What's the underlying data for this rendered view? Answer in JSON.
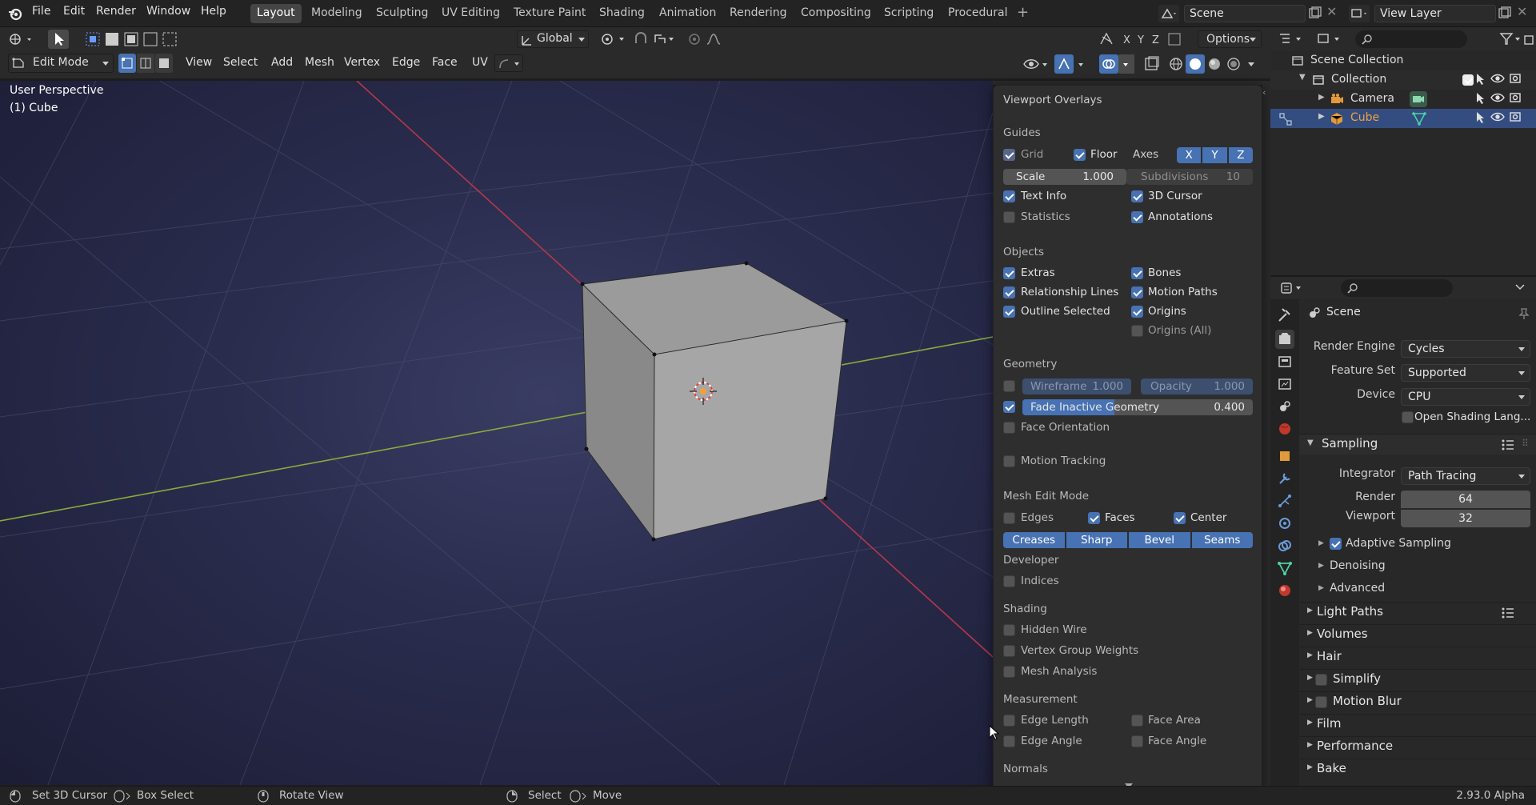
{
  "menu": {
    "file": "File",
    "edit": "Edit",
    "render": "Render",
    "window": "Window",
    "help": "Help"
  },
  "workspaces": [
    "Layout",
    "Modeling",
    "Sculpting",
    "UV Editing",
    "Texture Paint",
    "Shading",
    "Animation",
    "Rendering",
    "Compositing",
    "Scripting",
    "Procedural"
  ],
  "top_right": {
    "scene": "Scene",
    "view_layer": "View Layer"
  },
  "toolbar": {
    "orientation": "Global",
    "options": "Options"
  },
  "viewport_header": {
    "mode": "Edit Mode",
    "view": "View",
    "select": "Select",
    "add": "Add",
    "mesh": "Mesh",
    "vertex": "Vertex",
    "edge": "Edge",
    "face": "Face",
    "uv": "UV"
  },
  "viewport_info": {
    "perspective": "User Perspective",
    "object": "(1) Cube"
  },
  "overlays": {
    "title": "Viewport Overlays",
    "guides": "Guides",
    "grid": "Grid",
    "floor": "Floor",
    "axes": "Axes",
    "x": "X",
    "y": "Y",
    "z": "Z",
    "scale_label": "Scale",
    "scale_value": "1.000",
    "subdiv_label": "Subdivisions",
    "subdiv_value": "10",
    "text_info": "Text Info",
    "cursor_3d": "3D Cursor",
    "statistics": "Statistics",
    "annotations": "Annotations",
    "objects": "Objects",
    "extras": "Extras",
    "bones": "Bones",
    "relationship_lines": "Relationship Lines",
    "motion_paths": "Motion Paths",
    "outline_selected": "Outline Selected",
    "origins": "Origins",
    "origins_all": "Origins (All)",
    "geometry": "Geometry",
    "wireframe_label": "Wireframe",
    "wireframe_value": "1.000",
    "opacity_label": "Opacity",
    "opacity_value": "1.000",
    "fade_label": "Fade Inactive Geometry",
    "fade_value": "0.400",
    "fade_fraction": 0.4,
    "face_orientation": "Face Orientation",
    "motion_tracking": "Motion Tracking",
    "mesh_edit_mode": "Mesh Edit Mode",
    "edges": "Edges",
    "faces": "Faces",
    "center": "Center",
    "creases": "Creases",
    "sharp": "Sharp",
    "bevel": "Bevel",
    "seams": "Seams",
    "developer": "Developer",
    "indices": "Indices",
    "shading": "Shading",
    "hidden_wire": "Hidden Wire",
    "vertex_group_weights": "Vertex Group Weights",
    "mesh_analysis": "Mesh Analysis",
    "measurement": "Measurement",
    "edge_length": "Edge Length",
    "face_area": "Face Area",
    "edge_angle": "Edge Angle",
    "face_angle": "Face Angle",
    "normals": "Normals"
  },
  "outliner": {
    "scene_collection": "Scene Collection",
    "collection": "Collection",
    "camera": "Camera",
    "cube": "Cube"
  },
  "properties": {
    "scene": "Scene",
    "render_engine_label": "Render Engine",
    "render_engine": "Cycles",
    "feature_set_label": "Feature Set",
    "feature_set": "Supported",
    "device_label": "Device",
    "device": "CPU",
    "osl": "Open Shading Lang...",
    "sampling": "Sampling",
    "integrator_label": "Integrator",
    "integrator": "Path Tracing",
    "render_label": "Render",
    "render_value": "64",
    "viewport_label": "Viewport",
    "viewport_value": "32",
    "adaptive_sampling": "Adaptive Sampling",
    "denoising": "Denoising",
    "advanced": "Advanced",
    "light_paths": "Light Paths",
    "volumes": "Volumes",
    "hair": "Hair",
    "simplify": "Simplify",
    "motion_blur": "Motion Blur",
    "film": "Film",
    "performance": "Performance",
    "bake": "Bake"
  },
  "status": {
    "set_cursor": "Set 3D Cursor",
    "box_select": "Box Select",
    "rotate_view": "Rotate View",
    "select": "Select",
    "move": "Move",
    "version": "2.93.0 Alpha"
  }
}
